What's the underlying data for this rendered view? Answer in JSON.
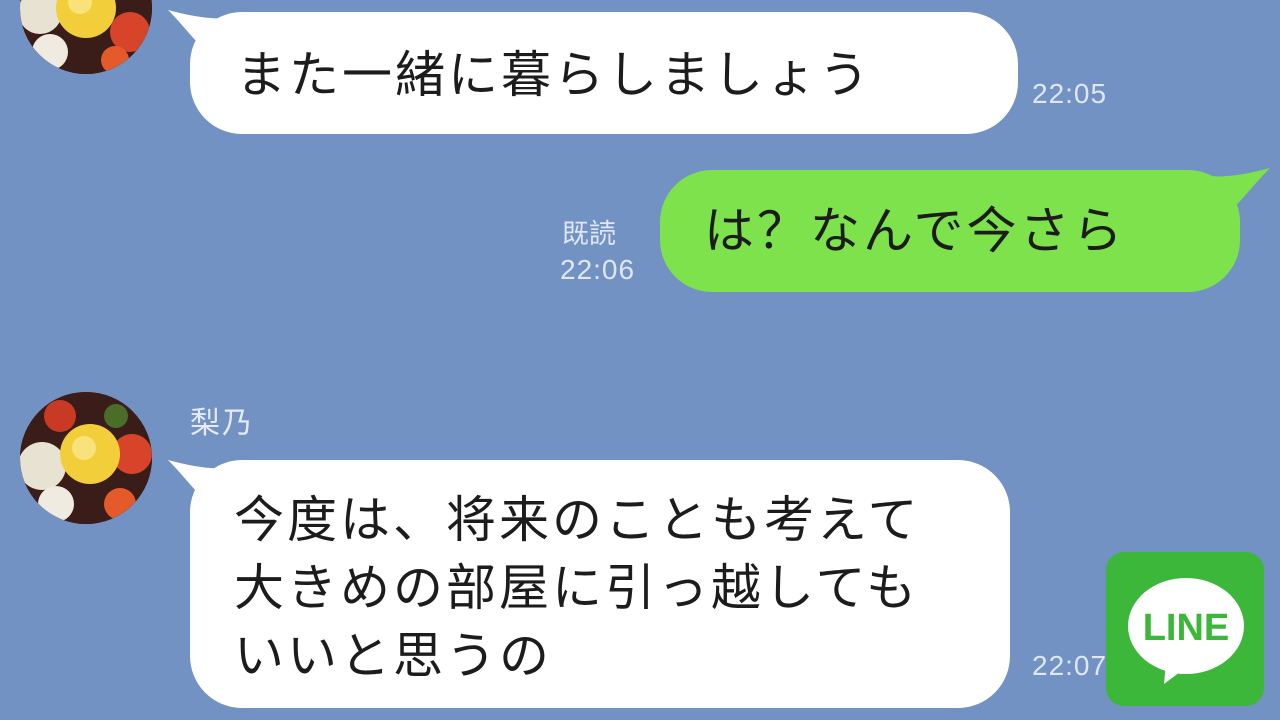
{
  "chat": {
    "messages": [
      {
        "text": "また一緒に暮らしましょう",
        "time": "22:05"
      },
      {
        "text": "は？なんで今さら",
        "time": "22:06",
        "read_label": "既読"
      },
      {
        "sender": "梨乃",
        "text": "今度は、将来のことも考えて大きめの部屋に引っ越してもいいと思うの",
        "time": "22:07"
      }
    ]
  },
  "badge": {
    "text": "LINE"
  },
  "colors": {
    "background": "#7292c4",
    "incoming_bubble": "#ffffff",
    "outgoing_bubble": "#7ee24c",
    "line_green": "#3cb73a"
  },
  "icons": [
    "avatar-flower-icon",
    "line-logo-icon"
  ]
}
